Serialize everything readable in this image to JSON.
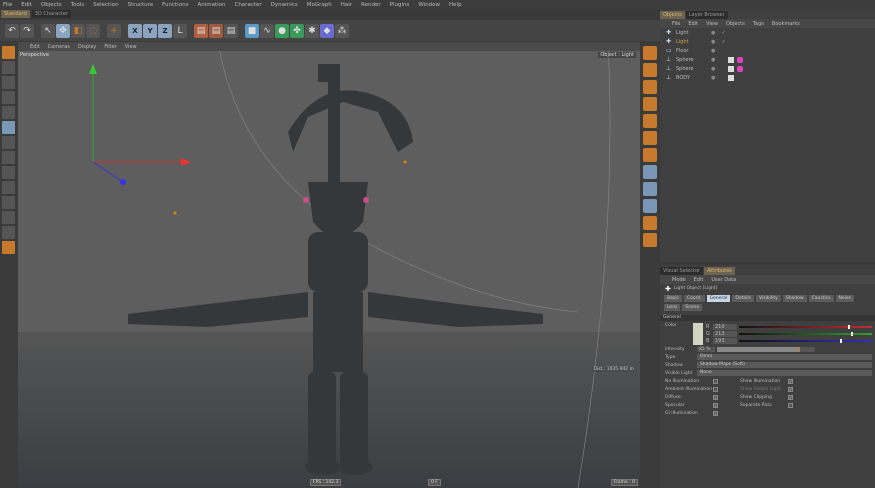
{
  "menubar": [
    "File",
    "Edit",
    "Objects",
    "Tools",
    "Selection",
    "Structure",
    "Functions",
    "Animation",
    "Character",
    "Dynamics",
    "MoGraph",
    "Hair",
    "Render",
    "Plugins",
    "Window",
    "Help"
  ],
  "layout_tabs": [
    "Standard",
    "3D Character"
  ],
  "toolbar_icons": [
    "undo-icon",
    "redo-icon",
    "live-selection-icon",
    "move-icon",
    "scale-icon",
    "rotate-icon",
    "add-object-icon",
    "x-axis-icon",
    "y-axis-icon",
    "z-axis-icon",
    "coordinate-system-icon",
    "render-view-icon",
    "render-picture-viewer-icon",
    "render-settings-icon",
    "cube-icon",
    "spline-icon",
    "nurbs-icon",
    "array-icon",
    "scene-icon",
    "deformer-icon",
    "environment-icon"
  ],
  "axis_labels": [
    "X",
    "Y",
    "Z"
  ],
  "viewport": {
    "menu": [
      "Edit",
      "Cameras",
      "Display",
      "Filter",
      "View"
    ],
    "label": "Perspective",
    "object_label": "Object : Light",
    "distance": "Dist.: 1035.942 m",
    "fps": "FPS : 142.3",
    "frame_center": "0 F",
    "frame": "Frame : 0"
  },
  "object_manager": {
    "tabs": [
      "Objects",
      "Layer Browser"
    ],
    "menu": [
      "File",
      "Edit",
      "View",
      "Objects",
      "Tags",
      "Bookmarks"
    ],
    "objects": [
      {
        "name": "Light",
        "color": "#bbbbbb"
      },
      {
        "name": "Light",
        "color": "#d9a34a"
      },
      {
        "name": "Floor",
        "color": "#bbbbbb"
      },
      {
        "name": "Sphere",
        "color": "#bbbbbb"
      },
      {
        "name": "Sphere",
        "color": "#bbbbbb"
      },
      {
        "name": "BODY",
        "color": "#bbbbbb"
      }
    ]
  },
  "attributes": {
    "tabs": [
      "Visual Selector",
      "Attributes"
    ],
    "menu": [
      "Mode",
      "Edit",
      "User Data"
    ],
    "object_title": "Light Object [Light]",
    "subtabs": [
      "Basic",
      "Coord.",
      "General",
      "Details",
      "Visibility",
      "Shadow",
      "Caustics",
      "Noise",
      "Lens",
      "Scene"
    ],
    "active_subtab": "General",
    "section": "General",
    "color_label": "Color",
    "color_swatch": "#d2d5c1",
    "rgb": [
      {
        "ch": "R",
        "value": "210",
        "fraction": 0.82,
        "color": "#c03030"
      },
      {
        "ch": "G",
        "value": "213",
        "fraction": 0.84,
        "color": "#30a030"
      },
      {
        "ch": "B",
        "value": "193",
        "fraction": 0.76,
        "color": "#3030c0"
      }
    ],
    "intensity_label": "Intensity",
    "intensity": "85 %",
    "intensity_fraction": 0.85,
    "type_label": "Type",
    "type": "Omni",
    "shadow_label": "Shadow",
    "shadow": "Shadow Maps (Soft)",
    "visible_light_label": "Visible Light",
    "visible_light": "None",
    "checks_left": [
      {
        "label": "No Illumination",
        "checked": false
      },
      {
        "label": "Ambient Illumination",
        "checked": false
      },
      {
        "label": "Diffuse",
        "checked": true
      },
      {
        "label": "Specular",
        "checked": true
      },
      {
        "label": "GI Illumination",
        "checked": true
      }
    ],
    "checks_right": [
      {
        "label": "Show Illumination",
        "checked": true
      },
      {
        "label": "Show Visible Light",
        "checked": true
      },
      {
        "label": "Show Clipping",
        "checked": true
      },
      {
        "label": "Separate Pass",
        "checked": false
      }
    ]
  },
  "accent_orange": "#c87a2c"
}
